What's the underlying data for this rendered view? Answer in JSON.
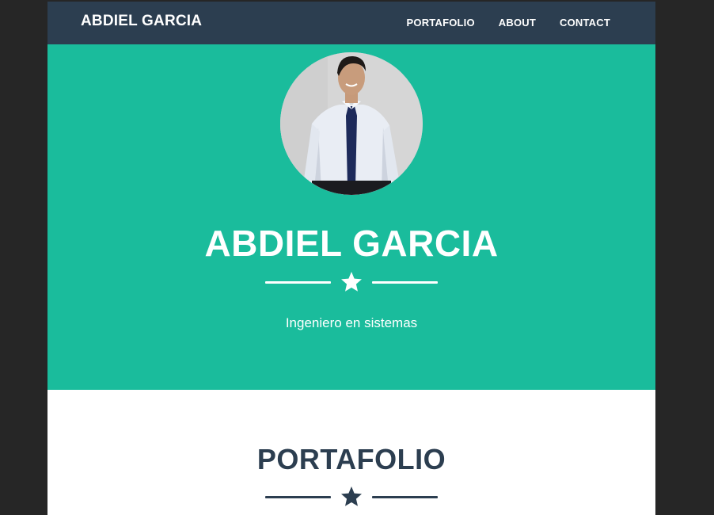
{
  "navbar": {
    "brand": "ABDIEL GARCIA",
    "links": [
      {
        "label": "PORTAFOLIO"
      },
      {
        "label": "ABOUT"
      },
      {
        "label": "CONTACT"
      }
    ]
  },
  "hero": {
    "name": "ABDIEL GARCIA",
    "divider_icon": "star-icon",
    "subtitle": "Ingeniero en sistemas"
  },
  "portfolio": {
    "title": "PORTAFOLIO",
    "divider_icon": "star-icon"
  },
  "colors": {
    "navbar_bg": "#2c3e50",
    "hero_bg": "#1abc9c",
    "section_title": "#2c3e50",
    "page_backdrop": "#262626"
  }
}
